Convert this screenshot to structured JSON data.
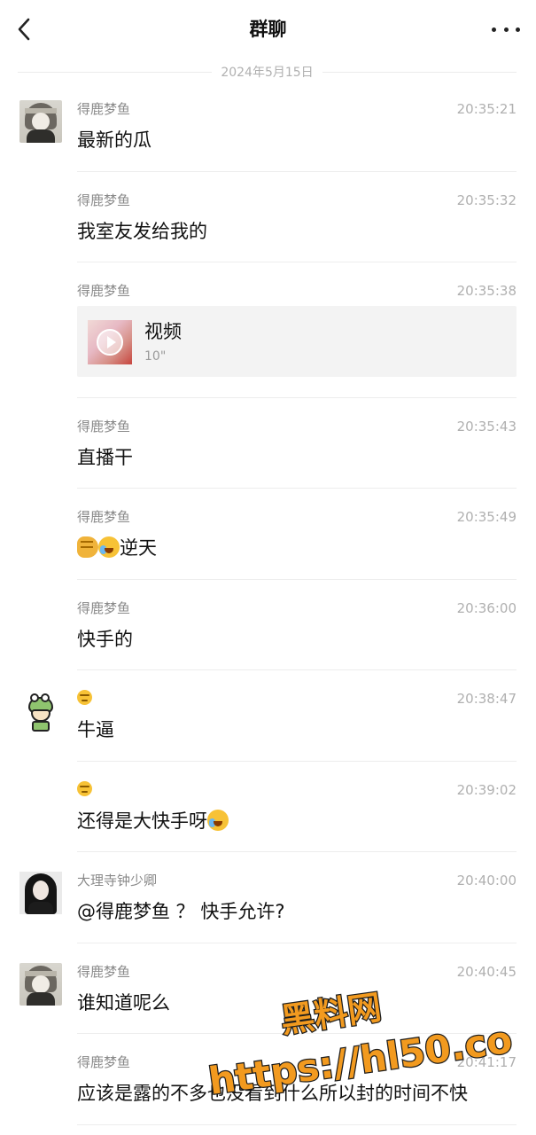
{
  "header": {
    "title": "群聊"
  },
  "date_separator": "2024年5月15日",
  "messages": [
    {
      "sender": "得鹿梦鱼",
      "time": "20:35:21",
      "text": "最新的瓜",
      "avatar": "girl-avatar"
    },
    {
      "sender": "得鹿梦鱼",
      "time": "20:35:32",
      "text": "我室友发给我的"
    },
    {
      "sender": "得鹿梦鱼",
      "time": "20:35:38",
      "video": {
        "label": "视频",
        "duration": "10\""
      }
    },
    {
      "sender": "得鹿梦鱼",
      "time": "20:35:43",
      "text": "直播干"
    },
    {
      "sender": "得鹿梦鱼",
      "time": "20:35:49",
      "text": "逆天",
      "emojis": [
        "fist-emoji",
        "crying-laughing-emoji"
      ]
    },
    {
      "sender": "得鹿梦鱼",
      "time": "20:36:00",
      "text": "快手的"
    },
    {
      "sender_icon": "expressionless-emoji",
      "time": "20:38:47",
      "text": "牛逼",
      "avatar": "frog-avatar"
    },
    {
      "sender_icon": "expressionless-emoji",
      "time": "20:39:02",
      "text": "还得是大快手呀",
      "emojis": [
        "crying-laughing-emoji"
      ]
    },
    {
      "sender": "大理寺钟少卿",
      "time": "20:40:00",
      "text": "@得鹿梦鱼 ？ 快手允许?",
      "avatar": "dark-hair-avatar"
    },
    {
      "sender": "得鹿梦鱼",
      "time": "20:40:45",
      "text": "谁知道呢么",
      "avatar": "girl-avatar"
    },
    {
      "sender": "得鹿梦鱼",
      "time": "20:41:17",
      "text": "应该是露的不多也没看到什么所以封的时间不快"
    }
  ],
  "watermark": {
    "line1": "黑料网",
    "line2": "https://hl50.co",
    "color": "#f29a1f"
  },
  "icons": {
    "back": "chevron-left-icon",
    "more": "more-dots-icon"
  }
}
